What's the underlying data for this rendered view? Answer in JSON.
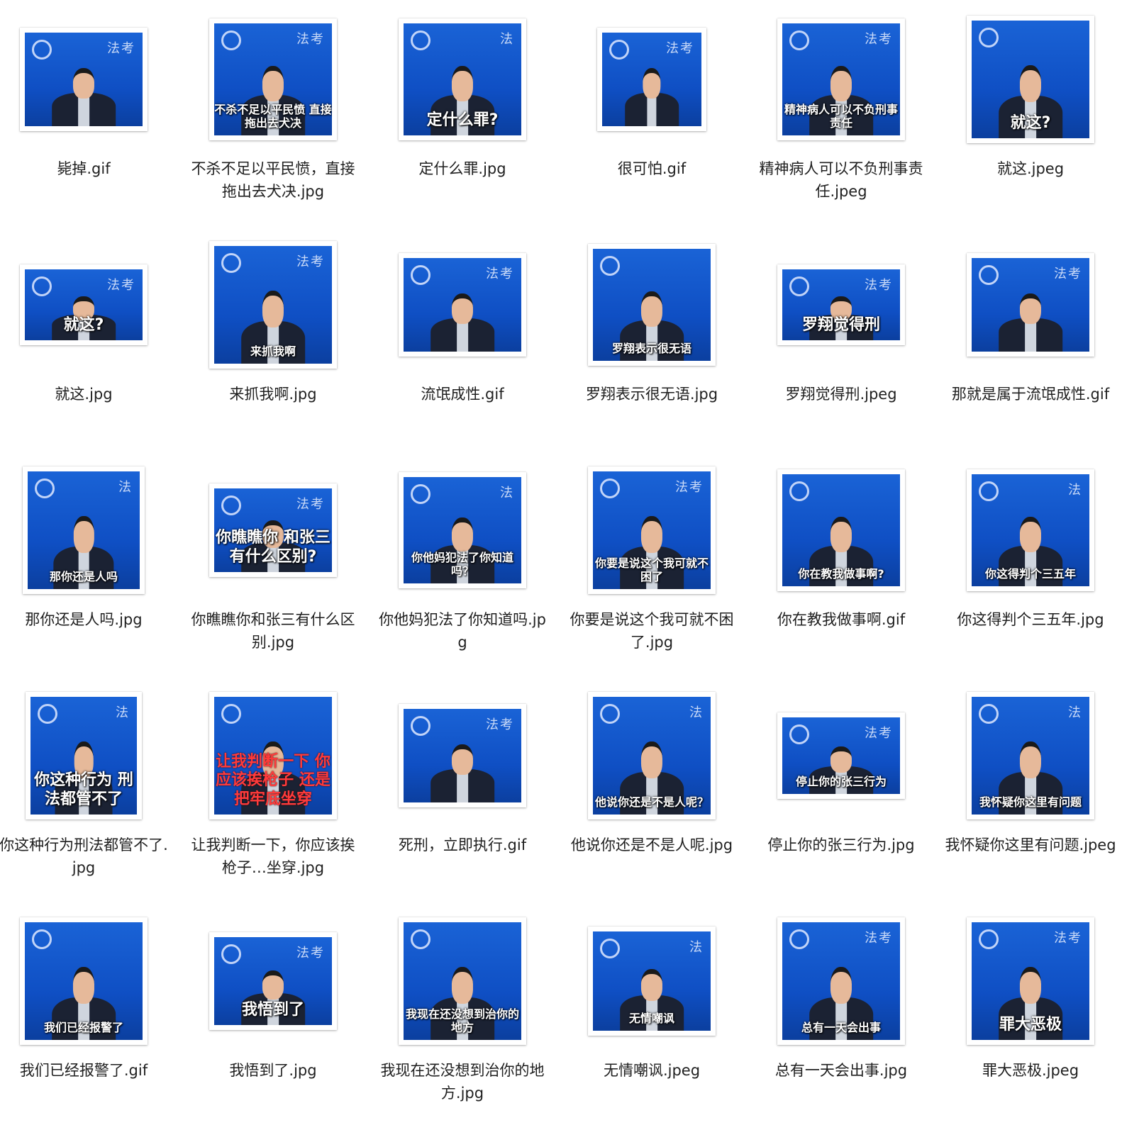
{
  "colors": {
    "background": "#ffffff",
    "thumbnail_blue": "#1554c9",
    "label_text": "#1f1f1f"
  },
  "files": [
    {
      "name": "毙掉.gif",
      "caption": "",
      "brand": "法考",
      "icon": "file-thumbnail"
    },
    {
      "name": "不杀不足以平民愤，直接拖出去犬决.jpg",
      "caption": "不杀不足以平民愤 直接拖出去犬决",
      "brand": "法考",
      "icon": "file-thumbnail"
    },
    {
      "name": "定什么罪.jpg",
      "caption": "定什么罪?",
      "brand": "法",
      "icon": "file-thumbnail"
    },
    {
      "name": "很可怕.gif",
      "caption": "",
      "brand": "法考",
      "icon": "file-thumbnail"
    },
    {
      "name": "精神病人可以不负刑事责任.jpeg",
      "caption": "精神病人可以不负刑事责任",
      "brand": "法考",
      "icon": "file-thumbnail"
    },
    {
      "name": "就这.jpeg",
      "caption": "就这?",
      "brand": "",
      "icon": "file-thumbnail"
    },
    {
      "name": "就这.jpg",
      "caption": "就这?",
      "brand": "法考",
      "icon": "file-thumbnail"
    },
    {
      "name": "来抓我啊.jpg",
      "caption": "来抓我啊",
      "brand": "法考",
      "icon": "file-thumbnail"
    },
    {
      "name": "流氓成性.gif",
      "caption": "",
      "brand": "法考",
      "icon": "file-thumbnail"
    },
    {
      "name": "罗翔表示很无语.jpg",
      "caption": "罗翔表示很无语",
      "brand": "",
      "icon": "file-thumbnail"
    },
    {
      "name": "罗翔觉得刑.jpeg",
      "caption": "罗翔觉得刑",
      "brand": "法考",
      "icon": "file-thumbnail"
    },
    {
      "name": "那就是属于流氓成性.gif",
      "caption": "",
      "brand": "法考",
      "icon": "file-thumbnail"
    },
    {
      "name": "那你还是人吗.jpg",
      "caption": "那你还是人吗",
      "brand": "法",
      "icon": "file-thumbnail"
    },
    {
      "name": "你瞧瞧你和张三有什么区别.jpg",
      "caption": "你瞧瞧你 和张三有什么区别?",
      "brand": "法考",
      "icon": "file-thumbnail"
    },
    {
      "name": "你他妈犯法了你知道吗.jpg",
      "caption": "你他妈犯法了你知道吗？",
      "brand": "法",
      "icon": "file-thumbnail"
    },
    {
      "name": "你要是说这个我可就不困了.jpg",
      "caption": "你要是说这个我可就不困了",
      "brand": "法考",
      "icon": "file-thumbnail"
    },
    {
      "name": "你在教我做事啊.gif",
      "caption": "你在教我做事啊?",
      "brand": "",
      "icon": "file-thumbnail"
    },
    {
      "name": "你这得判个三五年.jpg",
      "caption": "你这得判个三五年",
      "brand": "法",
      "icon": "file-thumbnail"
    },
    {
      "name": "你这种行为刑法都管不了.jpg",
      "caption": "你这种行为 刑法都管不了",
      "brand": "法",
      "icon": "file-thumbnail"
    },
    {
      "name": "让我判断一下，你应该挨枪子…坐穿.jpg",
      "caption": "让我判断一下 你应该挨枪子 还是把牢底坐穿",
      "brand": "",
      "icon": "file-thumbnail"
    },
    {
      "name": "死刑，立即执行.gif",
      "caption": "",
      "brand": "法考",
      "icon": "file-thumbnail"
    },
    {
      "name": "他说你还是不是人呢.jpg",
      "caption": "他说你还是不是人呢？",
      "brand": "法",
      "icon": "file-thumbnail"
    },
    {
      "name": "停止你的张三行为.jpg",
      "caption": "停止你的张三行为",
      "brand": "法考",
      "icon": "file-thumbnail"
    },
    {
      "name": "我怀疑你这里有问题.jpeg",
      "caption": "我怀疑你这里有问题",
      "brand": "法",
      "icon": "file-thumbnail"
    },
    {
      "name": "我们已经报警了.gif",
      "caption": "我们已经报警了",
      "brand": "",
      "icon": "file-thumbnail"
    },
    {
      "name": "我悟到了.jpg",
      "caption": "我悟到了",
      "brand": "法考",
      "icon": "file-thumbnail"
    },
    {
      "name": "我现在还没想到治你的地方.jpg",
      "caption": "我现在还没想到治你的地方",
      "brand": "",
      "icon": "file-thumbnail"
    },
    {
      "name": "无情嘲讽.jpeg",
      "caption": "无情嘲讽",
      "brand": "法",
      "icon": "file-thumbnail"
    },
    {
      "name": "总有一天会出事.jpg",
      "caption": "总有一天会出事",
      "brand": "法考",
      "icon": "file-thumbnail"
    },
    {
      "name": "罪大恶极.jpeg",
      "caption": "罪大恶极",
      "brand": "法考",
      "icon": "file-thumbnail"
    }
  ]
}
